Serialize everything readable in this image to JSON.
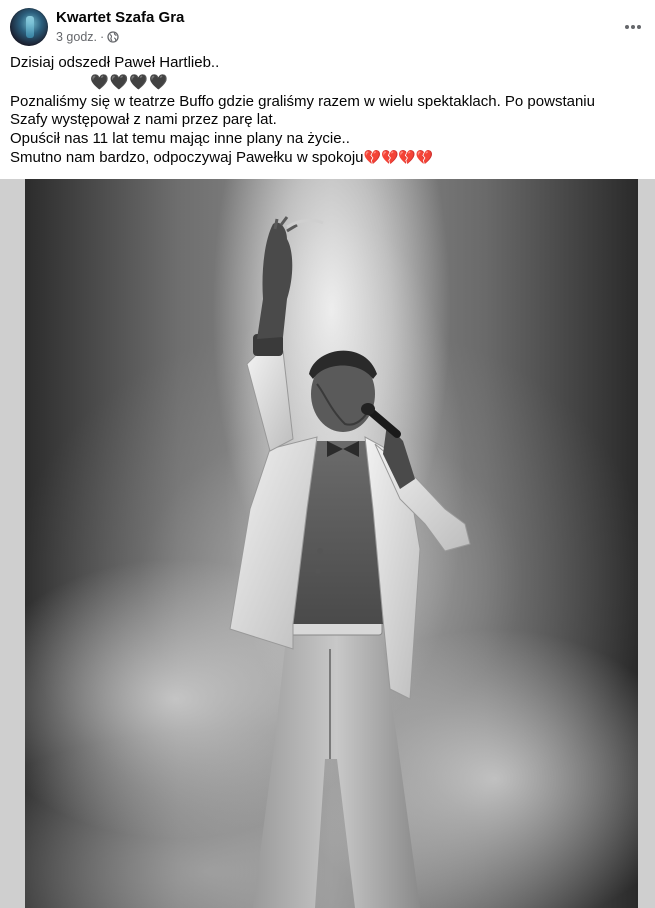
{
  "post": {
    "author": "Kwartet Szafa Gra",
    "time": "3 godz.",
    "separator": "·",
    "privacy_icon": "globe-icon",
    "more_icon": "more-dots-icon",
    "lines": [
      "Dzisiaj odszedł Paweł Hartlieb..",
      "Poznaliśmy się w teatrze Buffo gdzie graliśmy razem w wielu spektaklach. Po powstaniu Szafy występował z nami przez parę lat.",
      "Opuścił nas 11 lat temu mając inne plany na życie..",
      "Smutno nam bardzo, odpoczywaj Pawełku w spokoju"
    ],
    "black_hearts": [
      "🖤",
      "🖤",
      "🖤",
      "🖤"
    ],
    "broken_hearts": [
      "💔",
      "💔",
      "💔",
      "💔"
    ],
    "photo": {
      "description_icon": "performer-on-stage-photo",
      "tone": "black-and-white"
    }
  },
  "colors": {
    "text": "#050505",
    "secondary_text": "#65676b",
    "broken_heart": "#d92e3e",
    "photo_frame": "#cfcfcf"
  }
}
